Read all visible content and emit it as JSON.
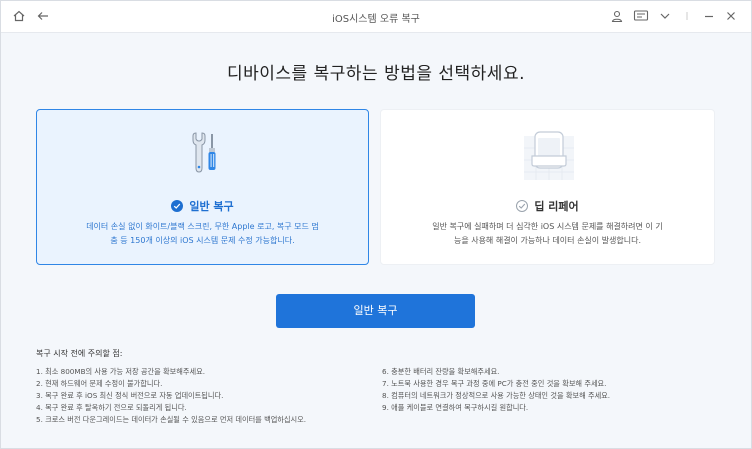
{
  "titlebar": {
    "title": "iOS시스템 오류 복구",
    "icons": [
      "home-icon",
      "back-arrow-icon",
      "user-icon",
      "chat-icon",
      "chevron-down-icon",
      "minimize-icon",
      "close-icon"
    ]
  },
  "page": {
    "title": "디바이스를 복구하는 방법을 선택하세요."
  },
  "options": [
    {
      "title": "일반 복구",
      "selected": true,
      "desc_line1": "데이터 손실 없이 화이트/블랙 스크린, 무한 Apple 로고, 복구 모드 멈",
      "desc_line2": "춤 등 150개 이상의 iOS 시스템 문제 수정 가능합니다."
    },
    {
      "title": "딥 리페어",
      "selected": false,
      "desc_line1": "일반 복구에 실패하며 더 심각한 iOS 시스템 문제를 해결하려면 이 기",
      "desc_line2": "능을 사용해 해결이 가능하나 데이터 손실이 발생합니다."
    }
  ],
  "primary_button": {
    "label": "일반 복구"
  },
  "notes": {
    "title": "복구 시작 전에 주의할 점:",
    "left": [
      "1. 최소 800MB의 사용 가능 저장 공간을 확보해주세요.",
      "2. 현재 하드웨어 문제 수정이 불가합니다.",
      "3. 복구 완료 후 iOS 최신 정식 버전으로 자동 업데이트됩니다.",
      "4. 복구 완료 후 탈옥하기 전으로 되돌리게 됩니다.",
      "5. 크로스 버전 다운그레이드는 데이터가 손실될 수 있음으로 먼저 데이터를 백업하십시오."
    ],
    "right": [
      "6. 충분한 배터리 잔량을 확보해주세요.",
      "7. 노트북 사용한 경우 복구 과정 중에 PC가 충전 중인 것을 확보해 주세요.",
      "8. 컴퓨터의 네트워크가 정상적으로 사용 가능한 상태인 것을 확보해 주세요.",
      "9. 애플 케이블로 연결하여 복구하시길 원합니다."
    ]
  },
  "colors": {
    "accent": "#1f74da",
    "selected_card_bg": "#eaf3fe",
    "selected_card_border": "#2f86e6",
    "page_bg": "#f4f7fb"
  }
}
